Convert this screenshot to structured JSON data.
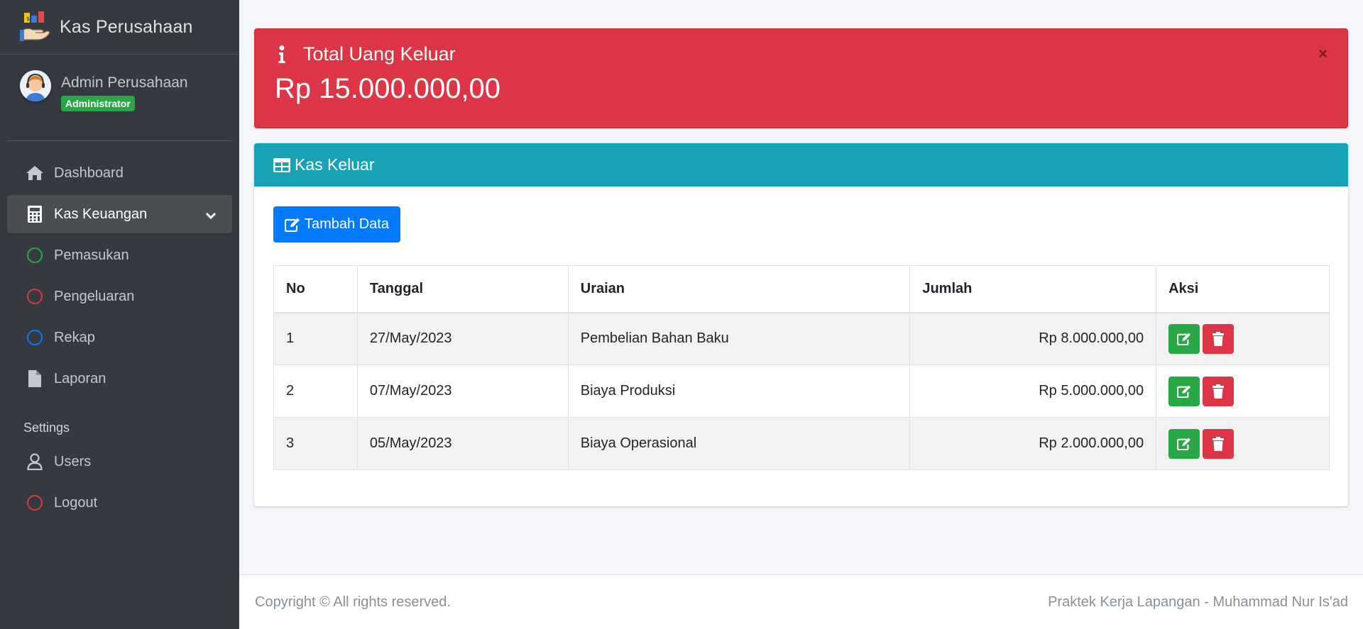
{
  "brand": {
    "title": "Kas Perusahaan",
    "logo_icon": "money-hand-logo-icon"
  },
  "user": {
    "name": "Admin Perusahaan",
    "role": "Administrator"
  },
  "sidebar": {
    "items": [
      {
        "label": "Dashboard",
        "icon": "home-icon"
      },
      {
        "label": "Kas Keuangan",
        "icon": "calculator-icon",
        "active": true
      },
      {
        "label": "Pemasukan",
        "icon": "circle-icon",
        "color": "#28a745"
      },
      {
        "label": "Pengeluaran",
        "icon": "circle-icon",
        "color": "#dc3545"
      },
      {
        "label": "Rekap",
        "icon": "circle-icon",
        "color": "#007bff"
      },
      {
        "label": "Laporan",
        "icon": "file-icon"
      }
    ],
    "settings_header": "Settings",
    "settings_items": [
      {
        "label": "Users",
        "icon": "user-icon"
      },
      {
        "label": "Logout",
        "icon": "circle-icon",
        "color": "#dc3545"
      }
    ]
  },
  "alert": {
    "title": "Total Uang Keluar",
    "value": "Rp 15.000.000,00",
    "close": "×",
    "color": "#dc3545"
  },
  "card": {
    "title": "Kas Keluar",
    "add_button": "Tambah Data",
    "header_color": "#17a2b8",
    "table": {
      "columns": [
        "No",
        "Tanggal",
        "Uraian",
        "Jumlah",
        "Aksi"
      ],
      "rows": [
        {
          "no": "1",
          "tanggal": "27/May/2023",
          "uraian": "Pembelian Bahan Baku",
          "jumlah": "Rp 8.000.000,00"
        },
        {
          "no": "2",
          "tanggal": "07/May/2023",
          "uraian": "Biaya Produksi",
          "jumlah": "Rp 5.000.000,00"
        },
        {
          "no": "3",
          "tanggal": "05/May/2023",
          "uraian": "Biaya Operasional",
          "jumlah": "Rp 2.000.000,00"
        }
      ]
    }
  },
  "footer": {
    "left": "Copyright © All rights reserved.",
    "right": "Praktek Kerja Lapangan - Muhammad Nur Is'ad"
  }
}
